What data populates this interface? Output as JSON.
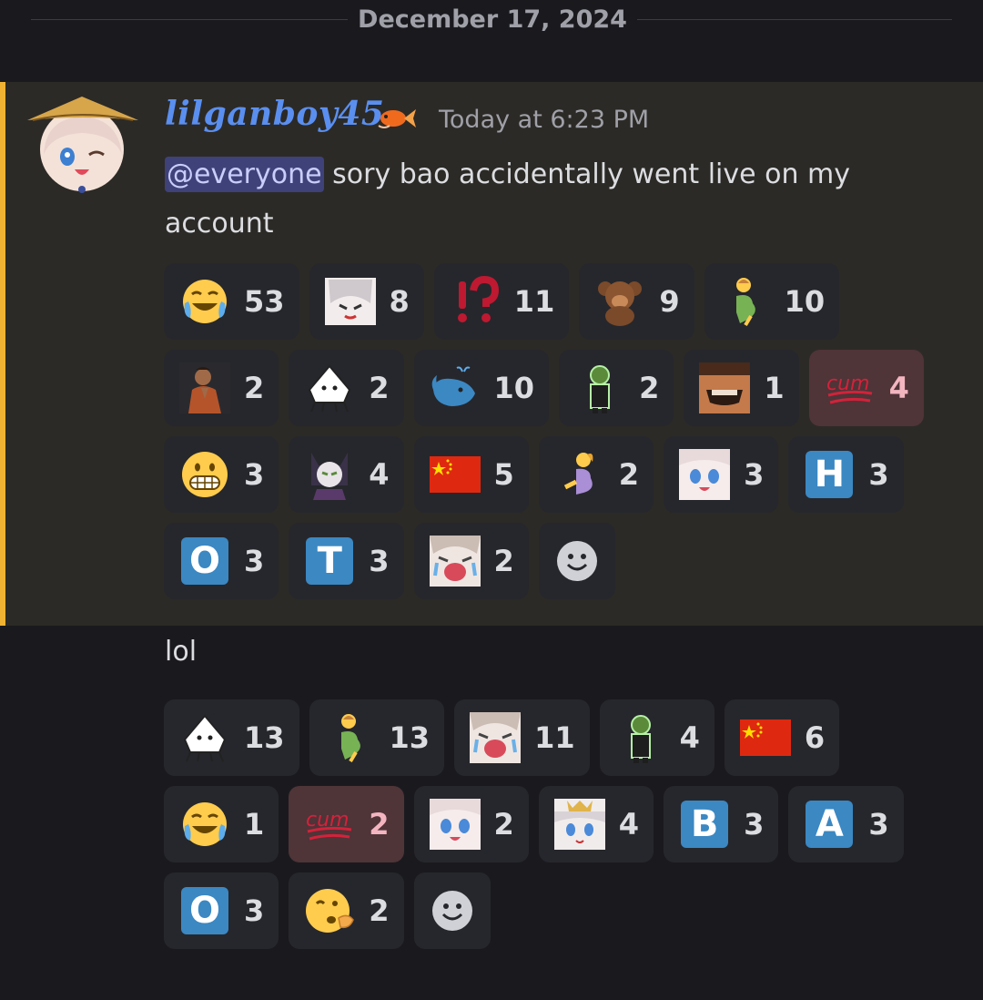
{
  "divider": {
    "date": "December 17, 2024"
  },
  "message": {
    "author": "lilganboy45",
    "timestamp": "Today at 6:23 PM",
    "mention": "@everyone",
    "text": " sory bao accidentally went live on my account",
    "second_text": "lol"
  },
  "reactions_1": [
    {
      "emoji": "joy-emoji",
      "count": "53"
    },
    {
      "emoji": "anime-girl-emoji",
      "count": "8"
    },
    {
      "emoji": "interrobang-emoji",
      "count": "11"
    },
    {
      "emoji": "monkey-emoji",
      "count": "9"
    },
    {
      "emoji": "pregnant-man-emoji",
      "count": "10"
    },
    {
      "emoji": "praying-man-emoji",
      "count": "2"
    },
    {
      "emoji": "doodle-cat-emoji",
      "count": "2"
    },
    {
      "emoji": "whale-emoji",
      "count": "10"
    },
    {
      "emoji": "pepe-suit-emoji",
      "count": "2"
    },
    {
      "emoji": "laughing-man-emoji",
      "count": "1"
    },
    {
      "emoji": "cum-emoji",
      "count": "4",
      "active": true
    },
    {
      "emoji": "grimacing-emoji",
      "count": "3"
    },
    {
      "emoji": "cat-girl-emoji",
      "count": "4"
    },
    {
      "emoji": "china-flag-emoji",
      "count": "5"
    },
    {
      "emoji": "pregnant-woman-emoji",
      "count": "2"
    },
    {
      "emoji": "anime-face-emoji",
      "count": "3"
    },
    {
      "emoji": "letter-h-emoji",
      "count": "3",
      "letter": "H"
    },
    {
      "emoji": "letter-o-emoji",
      "count": "3",
      "letter": "O"
    },
    {
      "emoji": "letter-t-emoji",
      "count": "3",
      "letter": "T"
    },
    {
      "emoji": "crying-anime-emoji",
      "count": "2"
    }
  ],
  "reactions_2": [
    {
      "emoji": "doodle-cat-emoji",
      "count": "13"
    },
    {
      "emoji": "pregnant-man-emoji",
      "count": "13"
    },
    {
      "emoji": "crying-anime-emoji",
      "count": "11"
    },
    {
      "emoji": "pepe-suit-emoji",
      "count": "4"
    },
    {
      "emoji": "china-flag-emoji",
      "count": "6"
    },
    {
      "emoji": "joy-emoji",
      "count": "1"
    },
    {
      "emoji": "cum-emoji",
      "count": "2",
      "active": true
    },
    {
      "emoji": "anime-face-emoji",
      "count": "2"
    },
    {
      "emoji": "anime-crown-emoji",
      "count": "4"
    },
    {
      "emoji": "letter-b-emoji",
      "count": "3",
      "letter": "B"
    },
    {
      "emoji": "letter-a-emoji",
      "count": "3",
      "letter": "A"
    },
    {
      "emoji": "letter-o-emoji",
      "count": "3",
      "letter": "O"
    },
    {
      "emoji": "blowing-kiss-emoji",
      "count": "2"
    }
  ],
  "colors": {
    "background": "#1a1a1e",
    "highlight": "#2c2a26",
    "highlight_bar": "#f0b232",
    "author": "#5a8ff0",
    "mention_bg": "#3e4278",
    "chip": "#26272c",
    "chip_active": "#4f3438"
  }
}
